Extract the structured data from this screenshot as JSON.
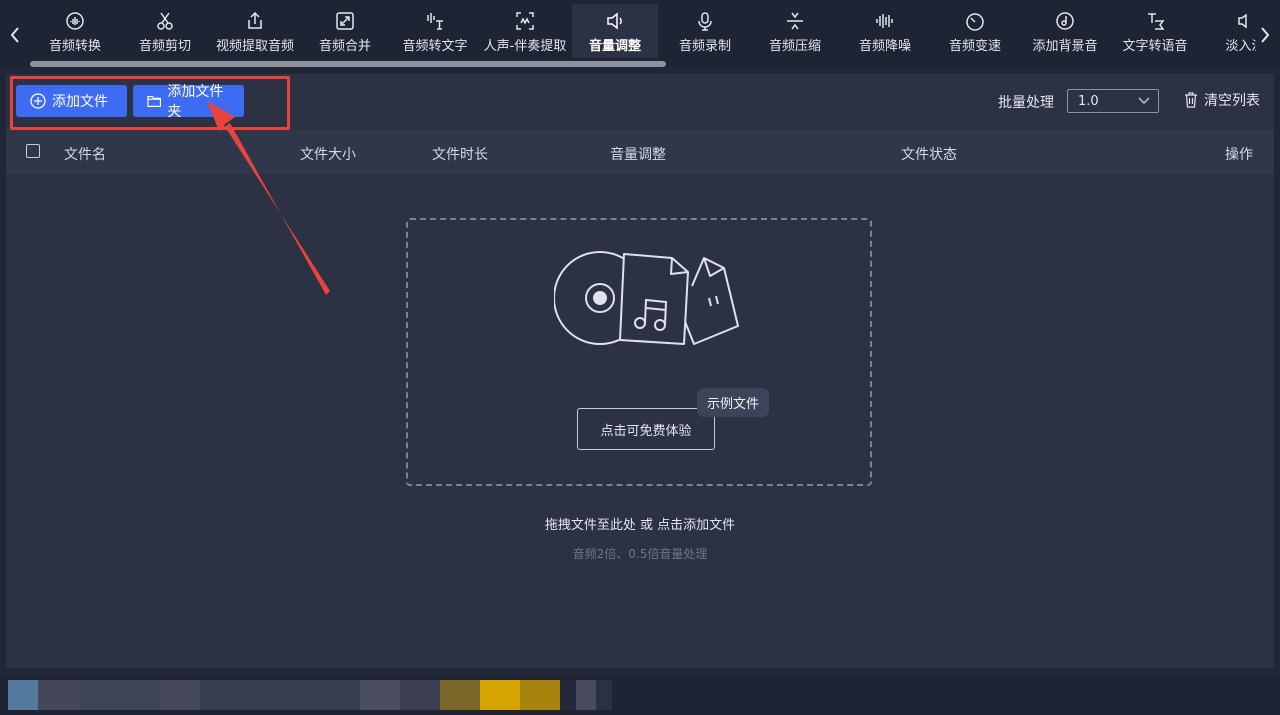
{
  "tabs": [
    {
      "label": "音频转换",
      "icon": "audio-wave-icon"
    },
    {
      "label": "音频剪切",
      "icon": "scissors-icon"
    },
    {
      "label": "视频提取音频",
      "icon": "upload-icon"
    },
    {
      "label": "音频合并",
      "icon": "merge-icon"
    },
    {
      "label": "音频转文字",
      "icon": "speech-to-text-icon"
    },
    {
      "label": "人声-伴奏提取",
      "icon": "vocal-extract-icon"
    },
    {
      "label": "音量调整",
      "icon": "speaker-icon",
      "active": true
    },
    {
      "label": "音频录制",
      "icon": "microphone-icon"
    },
    {
      "label": "音频压缩",
      "icon": "compress-icon"
    },
    {
      "label": "音频降噪",
      "icon": "noise-reduce-icon"
    },
    {
      "label": "音频变速",
      "icon": "speedometer-icon"
    },
    {
      "label": "添加背景音",
      "icon": "music-disc-icon"
    },
    {
      "label": "文字转语音",
      "icon": "text-to-speech-icon"
    },
    {
      "label": "淡入淡",
      "icon": "fade-speaker-icon"
    }
  ],
  "toolbar": {
    "add_file": "添加文件",
    "add_folder": "添加文件夹",
    "batch_label": "批量处理",
    "batch_value": "1.0",
    "clear_list": "清空列表"
  },
  "table": {
    "columns": [
      "文件名",
      "文件大小",
      "文件时长",
      "音量调整",
      "文件状态",
      "操作"
    ]
  },
  "dropzone": {
    "trial_button": "点击可免费体验",
    "sample_badge": "示例文件",
    "hint": "拖拽文件至此处 或 点击添加文件",
    "subhint": "音频2倍、0.5倍音量处理"
  },
  "colors": {
    "accent": "#3d6cf2",
    "annotation": "#e8443c",
    "panel": "#2c3144",
    "background": "#222738"
  }
}
